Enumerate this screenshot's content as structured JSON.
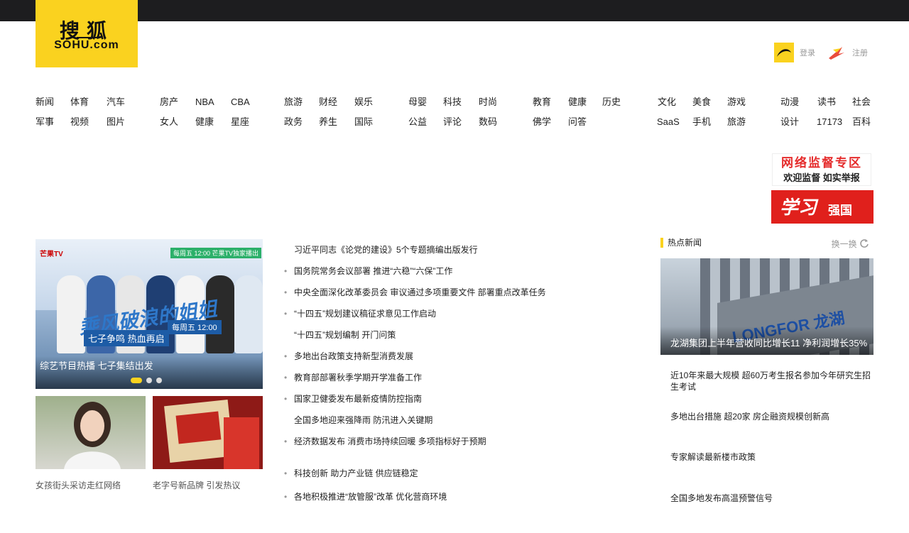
{
  "logo": {
    "cn": "搜狐",
    "en": "SOHU.com"
  },
  "user": [
    {
      "label": "登录"
    },
    {
      "label": "注册"
    }
  ],
  "nav": {
    "row1": [
      "新闻",
      "体育",
      "汽车",
      "房产",
      "NBA",
      "CBA",
      "旅游",
      "财经",
      "娱乐",
      "母婴",
      "科技",
      "时尚",
      "教育",
      "健康",
      "历史",
      "文化",
      "美食",
      "游戏",
      "动漫",
      "读书",
      "社会"
    ],
    "row2": [
      "军事",
      "视频",
      "图片",
      "女人",
      "健康",
      "星座",
      "政务",
      "养生",
      "国际",
      "公益",
      "评论",
      "数码",
      "佛学",
      "问答",
      "SaaS",
      "手机",
      "旅游",
      "设计",
      "17173",
      "百科"
    ]
  },
  "ads": {
    "supervision_title": "网络监督专区",
    "supervision_sub": "欢迎监督 如实举报",
    "xuexi_left": "学习",
    "xuexi_right": "强国"
  },
  "focus": {
    "badge": "芒果TV",
    "badge2": "每周五 12:00 芒果TV独家播出",
    "show_title": "乘风破浪的姐姐",
    "show_line2": "七子争鸣 热血再启",
    "show_line3": "每周五 12:00",
    "caption": "综艺节目热播 七子集结出发"
  },
  "thumbs": [
    {
      "caption": "女孩街头采访走红网络"
    },
    {
      "caption": "老字号新品牌 引发热议"
    }
  ],
  "news": [
    {
      "bullet": "",
      "text": "习近平同志《论党的建设》5个专题摘编出版发行"
    },
    {
      "bullet": "•",
      "text": "国务院常务会议部署 推进“六稳”“六保”工作"
    },
    {
      "bullet": "•",
      "text": "中央全面深化改革委员会 审议通过多项重要文件 部署重点改革任务"
    },
    {
      "bullet": "•",
      "text": "“十四五”规划建议稿征求意见工作启动"
    },
    {
      "bullet": "",
      "text": "“十四五”规划编制 开门问策"
    },
    {
      "bullet": "•",
      "text": "多地出台政策支持新型消费发展"
    },
    {
      "bullet": "•",
      "text": "教育部部署秋季学期开学准备工作"
    },
    {
      "bullet": "•",
      "text": "国家卫健委发布最新疫情防控指南"
    },
    {
      "bullet": "",
      "text": "全国多地迎来强降雨 防汛进入关键期"
    },
    {
      "bullet": "•",
      "text": "经济数据发布 消费市场持续回暖 多项指标好于预期"
    },
    {
      "bullet": "•",
      "text": "科技创新 助力产业链 供应链稳定"
    },
    {
      "bullet": "•",
      "text": "各地积极推进“放管服”改革 优化营商环境"
    }
  ],
  "hot": {
    "title": "热点新闻",
    "ctl": "换一换",
    "image_brand": "LONGFOR 龙湖",
    "image_caption": "龙湖集团上半年营收同比增长11 净利润增长35%",
    "items": [
      {
        "text": "近10年来最大规模 超60万考生报名参加今年研究生招生考试"
      },
      {
        "text": "多地出台措施 超20家 房企融资规模创新高"
      },
      {
        "text": "专家解读最新楼市政策"
      },
      {
        "text": "全国多地发布高温预警信号"
      }
    ]
  }
}
